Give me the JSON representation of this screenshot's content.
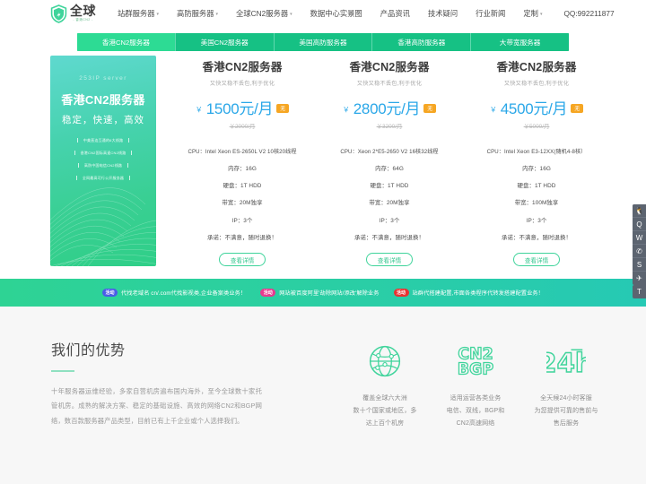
{
  "header": {
    "logo": {
      "main": "全球",
      "sub": "- 香港CN2 -",
      "icon": "shield-icon"
    },
    "nav": [
      {
        "label": "站群服务器",
        "has_caret": true
      },
      {
        "label": "高防服务器",
        "has_caret": true
      },
      {
        "label": "全球CN2服务器",
        "has_caret": true
      },
      {
        "label": "数据中心实景图",
        "has_caret": false
      },
      {
        "label": "产品资讯",
        "has_caret": false
      },
      {
        "label": "技术疑问",
        "has_caret": false
      },
      {
        "label": "行业新闻",
        "has_caret": false
      },
      {
        "label": "定制",
        "has_caret": true
      }
    ],
    "qq": "QQ:992211877"
  },
  "tabs": [
    {
      "label": "香港CN2服务器",
      "active": true
    },
    {
      "label": "美国CN2服务器",
      "active": false
    },
    {
      "label": "美国高防服务器",
      "active": false
    },
    {
      "label": "香港高防服务器",
      "active": false
    },
    {
      "label": "大带宽服务器",
      "active": false
    }
  ],
  "promo": {
    "eyebrow": "253IP server",
    "title": "香港CN2服务器",
    "subtitle": "稳定，快速，高效",
    "items": [
      "中美直连互通的6大线路",
      "香港CN2国际高速CN2线路",
      "高防中国电信CN2线路",
      "全网最高可行公开服务器"
    ]
  },
  "cards": [
    {
      "title": "香港CN2服务器",
      "subtitle": "又快又稳不丢包,利于优化",
      "currency": "￥",
      "price": "1500元/月",
      "badge": "无",
      "old_price": "￥2000/月",
      "specs": [
        "CPU：Intel Xeon ES-2650L V2 10核20线程",
        "内存：16G",
        "硬盘：1T HDD",
        "带宽：20M独享",
        "IP：3个",
        "承诺：不满意，随时退换！"
      ],
      "button": "查看详情"
    },
    {
      "title": "香港CN2服务器",
      "subtitle": "又快又稳不丢包,利于优化",
      "currency": "￥",
      "price": "2800元/月",
      "badge": "无",
      "old_price": "￥3200/月",
      "specs": [
        "CPU：Xeon 2*E5-2650 V2 16核32线程",
        "内存：64G",
        "硬盘：1T HDD",
        "带宽：20M独享",
        "IP：3个",
        "承诺：不满意，随时退换！"
      ],
      "button": "查看详情"
    },
    {
      "title": "香港CN2服务器",
      "subtitle": "又快又稳不丢包,利于优化",
      "currency": "￥",
      "price": "4500元/月",
      "badge": "无",
      "old_price": "￥5000/月",
      "specs": [
        "CPU：Intel Xeon E3-12XX(随机4-8核）",
        "内存：16G",
        "硬盘：1T HDD",
        "带宽：100M独享",
        "IP：3个",
        "承诺：不满意，随时退换！"
      ],
      "button": "查看详情"
    }
  ],
  "strip": [
    {
      "badge": "活动",
      "badge_color": "#4b5ce8",
      "text": "代找老域名  cn/.com代找影视类,企业备案类业务！"
    },
    {
      "badge": "活动",
      "badge_color": "#e8398f",
      "text": "网站被百度阿里'劫除网站/添改'解除业务"
    },
    {
      "badge": "活动",
      "badge_color": "#e83232",
      "text": "站群代搭建配置,市面各类程序代转发搭建配置业务！"
    }
  ],
  "advantage": {
    "heading": "我们的优势",
    "paragraph": "十年服务器运维经验，多家自营机房遍布国内海外，至今全球数十家托管机房。成熟的解决方案、稳定的基础设施、高效的网络CN2和BGP网络，数百款服务器产品类型，目前已有上千企业或个人选择我们。",
    "features": [
      {
        "icon": "globe-icon",
        "text": "覆盖全球六大洲\n数十个国家或地区，多\n达上百个机房"
      },
      {
        "icon": "cn2-bgp-icon",
        "text": "适用运营各类业务\n电信、双线，BGP和\nCN2高速网络"
      },
      {
        "icon": "24h-icon",
        "text": "全天候24小时客服\n为您提供可靠的售前与\n售后服务"
      }
    ]
  },
  "sidebar": [
    {
      "icon": "qq-icon",
      "glyph": "🐧"
    },
    {
      "icon": "qq-chat-icon",
      "glyph": "Q"
    },
    {
      "icon": "wechat-icon",
      "glyph": "W"
    },
    {
      "icon": "phone-icon",
      "glyph": "✆"
    },
    {
      "icon": "skype-icon",
      "glyph": "S"
    },
    {
      "icon": "telegram-icon",
      "glyph": "✈"
    }
  ],
  "back_to_top": {
    "icon": "arrow-up-icon",
    "glyph": "T"
  }
}
